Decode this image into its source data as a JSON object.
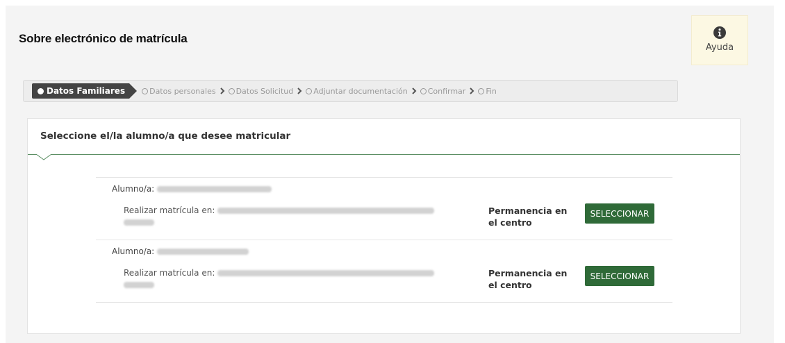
{
  "header": {
    "title": "Sobre electrónico de matrícula"
  },
  "help": {
    "label": "Ayuda",
    "icon": "info-circle-icon"
  },
  "stepper": {
    "active_step": "Datos Familiares",
    "steps": [
      "Datos personales",
      "Datos Solicitud",
      "Adjuntar documentación",
      "Confirmar",
      "Fin"
    ]
  },
  "card": {
    "title": "Seleccione el/la alumno/a que desee matricular"
  },
  "alumnos": [
    {
      "alumno_label": "Alumno/a:",
      "matricula_label": "Realizar matrícula en:",
      "permanencia": "Permanencia en el centro",
      "button": "SELECCIONAR"
    },
    {
      "alumno_label": "Alumno/a:",
      "matricula_label": "Realizar matrícula en:",
      "permanencia": "Permanencia en el centro",
      "button": "SELECCIONAR"
    }
  ],
  "colors": {
    "accent_green": "#2f6a38",
    "divider_green": "#5c8f64",
    "help_bg": "#fcf8e3",
    "stepper_active": "#444444"
  }
}
